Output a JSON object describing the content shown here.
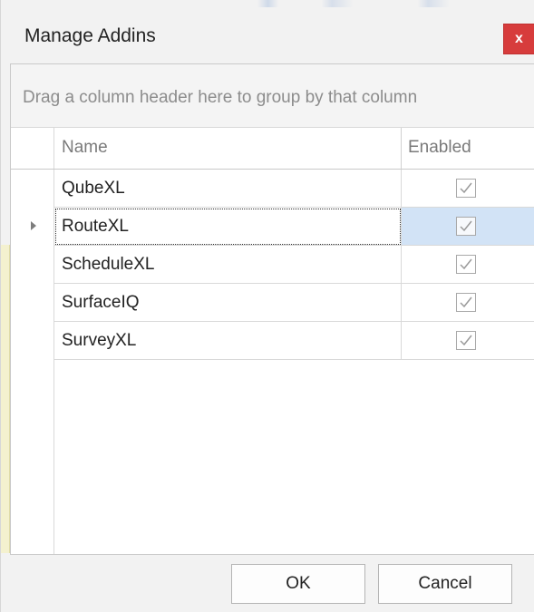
{
  "dialog": {
    "title": "Manage Addins",
    "close_label": "x"
  },
  "grid": {
    "group_panel_text": "Drag a column header here to group by that column",
    "columns": [
      {
        "label": "Name"
      },
      {
        "label": "Enabled"
      }
    ],
    "rows": [
      {
        "name": "QubeXL",
        "enabled": true
      },
      {
        "name": "RouteXL",
        "enabled": true
      },
      {
        "name": "ScheduleXL",
        "enabled": true
      },
      {
        "name": "SurfaceIQ",
        "enabled": true
      },
      {
        "name": "SurveyXL",
        "enabled": true
      }
    ],
    "focused_row_index": 1
  },
  "footer": {
    "ok_label": "OK",
    "cancel_label": "Cancel"
  },
  "icons": {
    "close": "close-icon",
    "row_indicator": "focused-row-arrow-icon",
    "check": "check-icon"
  },
  "colors": {
    "close_button": "#d73c3c",
    "selected_cell": "#d2e3f6"
  }
}
